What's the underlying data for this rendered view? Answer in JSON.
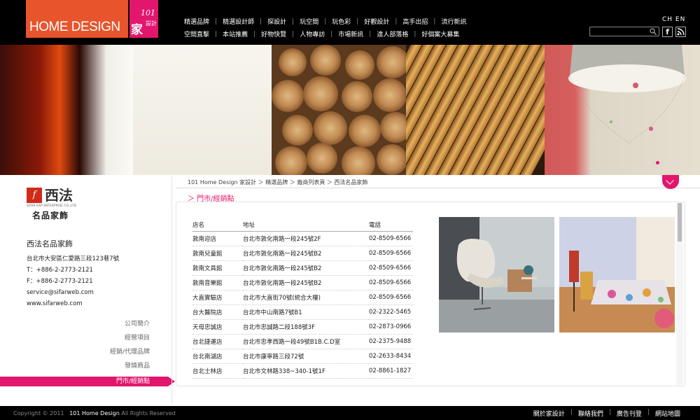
{
  "logo": {
    "text": "HOME DESIGN",
    "num": "101",
    "cn": "家",
    "cn_small": "設計"
  },
  "nav": {
    "row1": [
      "精選品牌",
      "精選設計師",
      "探設計",
      "玩空間",
      "玩色彩",
      "好觀設計",
      "高手出招",
      "流行新訊"
    ],
    "row2": [
      "空間直擊",
      "本站推薦",
      "好物快覽",
      "人物專訪",
      "市場新訊",
      "達人部落格",
      "好個案大募集"
    ],
    "lang": "CH EN"
  },
  "search": {
    "placeholder": ""
  },
  "brand": {
    "tag": "名品家飾",
    "cn_logo": "西法",
    "small": "SIFAR EAP ENTERPRISE CO.,LTD"
  },
  "info": {
    "name": "西法名品家飾",
    "address": "台北市大安區仁愛路三段123巷7號",
    "tel": "T：+886-2-2773-2121",
    "fax": "F：+886-2-2773-2121",
    "email": "service@sifarweb.com",
    "web": "www.sifarweb.com"
  },
  "leftnav": [
    "公司簡介",
    "經營項目",
    "經銷/代理品牌",
    "發燒商品",
    "門市/經銷點"
  ],
  "breadcrumb": "101 Home Design 家設計 ＞ 精選品牌 ＞ 廠商列表頁 ＞ 西法名品家飾",
  "section_title": "＞ 門市/經銷點",
  "table": {
    "headers": [
      "店名",
      "地址",
      "電話"
    ],
    "rows": [
      [
        "敦南迎店",
        "台北市敦化南路一段245號2F",
        "02-8509-6566"
      ],
      [
        "敦南兒童館",
        "台北市敦化南路一段245號B2",
        "02-8509-6566"
      ],
      [
        "敦南文具館",
        "台北市敦化南路一段245號B2",
        "02-8509-6566"
      ],
      [
        "敦南音樂館",
        "台北市敦化南路一段245號B2",
        "02-8509-6566"
      ],
      [
        "大直實驗店",
        "台北市大直街70號(統合大樓)",
        "02-8509-6566"
      ],
      [
        "台大醫院店",
        "台北市中山南路7號B1",
        "02-2322-5465"
      ],
      [
        "天母忠誠店",
        "台北市忠誠路二段188號3F",
        "02-2873-0966"
      ],
      [
        "台北捷運店",
        "台北市忠孝西路一段49號B1B.C.D室",
        "02-2375-9488"
      ],
      [
        "台北南湖店",
        "台北市康寧路三段72號",
        "02-2633-8434"
      ],
      [
        "台北士林店",
        "台北市文林路338~340-1號1F",
        "02-8861-1827"
      ]
    ]
  },
  "footer": {
    "copy": "Copyright © 2011",
    "company": "101 Home Design",
    "rights": "All Rights Reserved",
    "links": [
      "關於家設計",
      "聯絡我們",
      "廣告刊登",
      "網站地圖"
    ]
  }
}
